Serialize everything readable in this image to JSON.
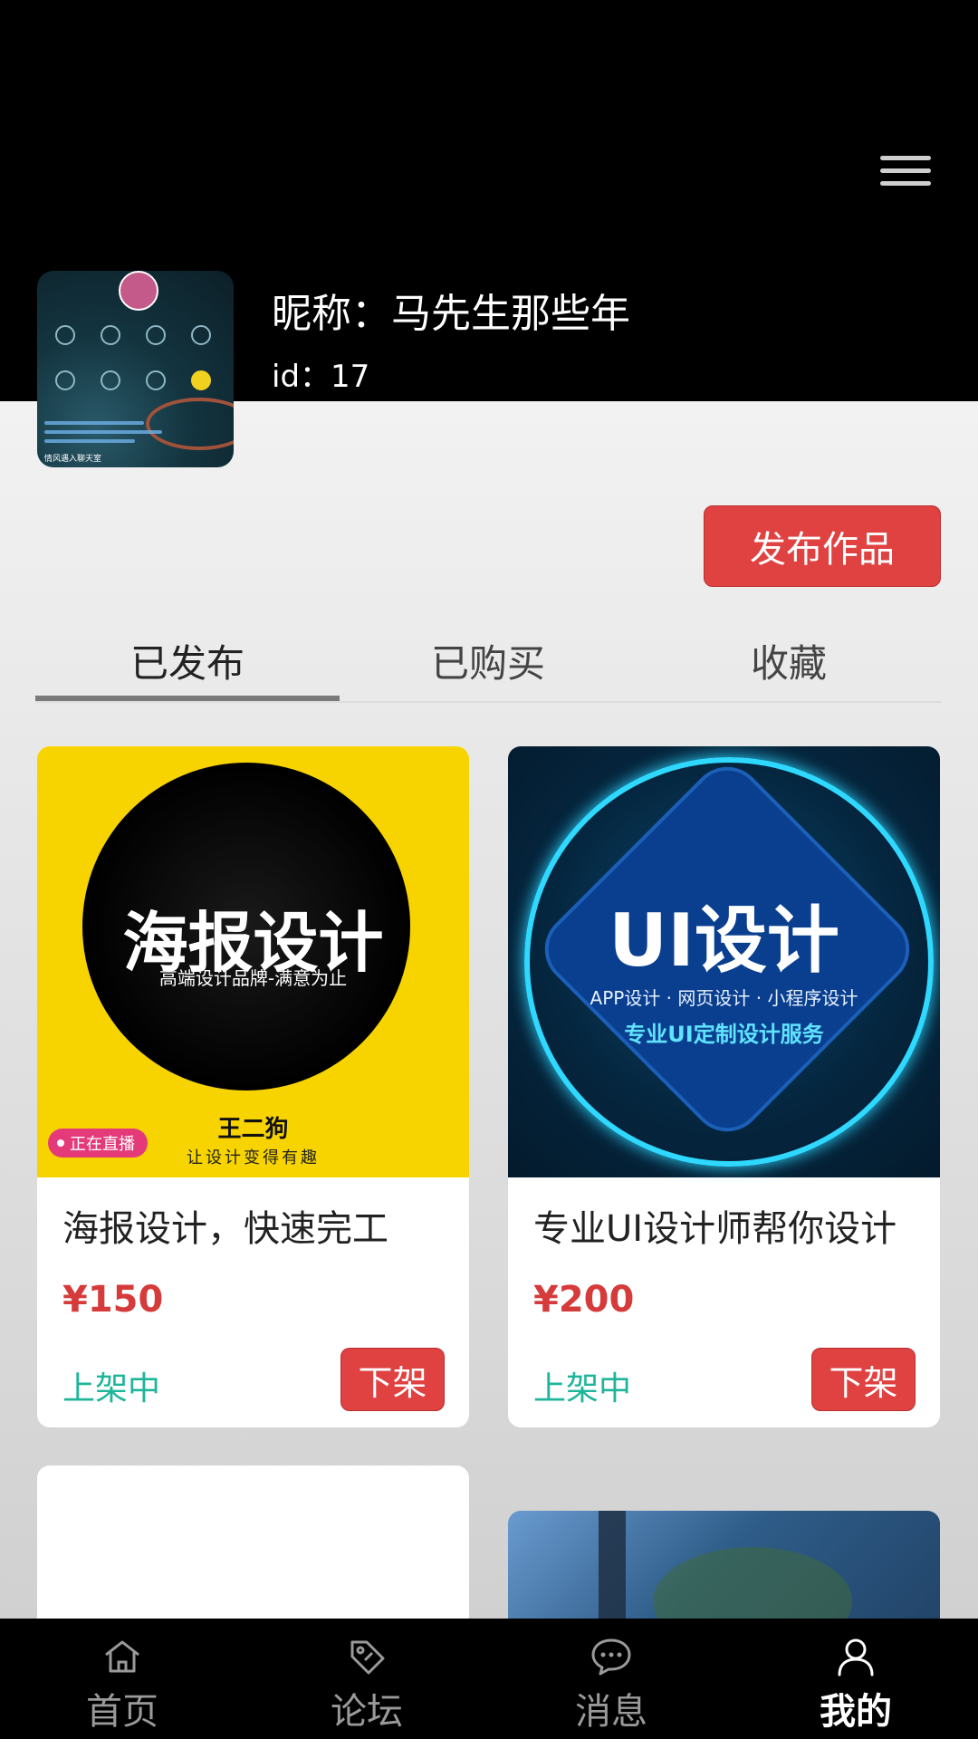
{
  "profile": {
    "nickname": "昵称：马先生那些年",
    "id_text": "id：17",
    "avatar_caption": "情风遇入聊天室"
  },
  "header": {
    "menu_icon": "menu-icon"
  },
  "publish_button": "发布作品",
  "tabs": [
    {
      "label": "已发布",
      "active": true
    },
    {
      "label": "已购买",
      "active": false
    },
    {
      "label": "收藏",
      "active": false
    }
  ],
  "items": [
    {
      "title": "海报设计，快速完工",
      "price": "¥150",
      "status": "上架中",
      "action": "下架",
      "thumb": {
        "headline": "海报设计",
        "subline": "高端设计品牌-满意为止",
        "brand": "王二狗",
        "slogan": "让设计变得有趣",
        "live_badge": "正在直播"
      }
    },
    {
      "title": "专业UI设计师帮你设计",
      "price": "¥200",
      "status": "上架中",
      "action": "下架",
      "thumb": {
        "headline": "UI设计",
        "subline": "APP设计 · 网页设计 · 小程序设计",
        "subline2": "专业UI定制设计服务"
      }
    }
  ],
  "nav": [
    {
      "label": "首页",
      "icon": "home-icon",
      "active": false
    },
    {
      "label": "论坛",
      "icon": "tag-icon",
      "active": false
    },
    {
      "label": "消息",
      "icon": "chat-icon",
      "active": false
    },
    {
      "label": "我的",
      "icon": "user-icon",
      "active": true
    }
  ],
  "colors": {
    "accent_red": "#e04141",
    "price_red": "#d63b3b",
    "status_green": "#1fb59a",
    "header_bg": "#000000"
  }
}
